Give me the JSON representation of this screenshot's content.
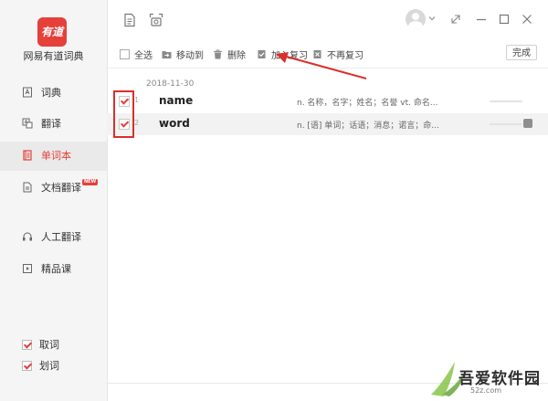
{
  "app": {
    "logo_text": "有道",
    "name": "网易有道词典"
  },
  "sidebar": {
    "items": [
      {
        "label": "词典",
        "icon": "dictionary-icon",
        "active": false
      },
      {
        "label": "翻译",
        "icon": "translate-icon",
        "active": false
      },
      {
        "label": "单词本",
        "icon": "wordbook-icon",
        "active": true
      },
      {
        "label": "文档翻译",
        "icon": "document-translate-icon",
        "active": false,
        "badge": "NEW"
      },
      {
        "label": "人工翻译",
        "icon": "human-translate-icon",
        "active": false
      },
      {
        "label": "精品课",
        "icon": "course-icon",
        "active": false
      }
    ],
    "options": [
      {
        "label": "取词",
        "checked": true
      },
      {
        "label": "划词",
        "checked": true
      }
    ]
  },
  "toolbar": {
    "select_all": "全选",
    "move_to": "移动到",
    "delete": "删除",
    "add_review": "加入复习",
    "no_review": "不再复习",
    "done": "完成"
  },
  "wordlist": {
    "date": "2018-11-30",
    "rows": [
      {
        "index": "1",
        "word": "name",
        "definition": "n. 名称，名字；姓名；名誉  vt. 命名...",
        "checked": true,
        "progress": 0.0
      },
      {
        "index": "2",
        "word": "word",
        "definition": "n. [语] 单词；话语；消息；诺言；命...",
        "checked": true,
        "progress": 0.0
      }
    ]
  },
  "watermark": {
    "text": "吾爱软件园",
    "sub": "52z.com"
  },
  "colors": {
    "accent": "#e5403a",
    "annotation": "#d9302b",
    "sidebar_bg": "#f5f5f5"
  }
}
